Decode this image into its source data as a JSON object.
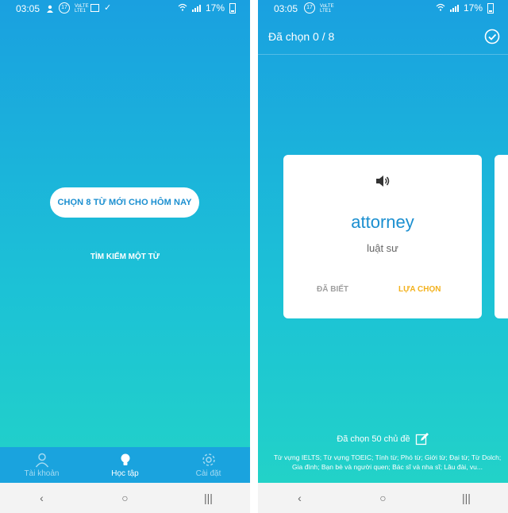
{
  "status_bar": {
    "time": "03:05",
    "battery": "17%",
    "left_badge": "17",
    "network_label": "VoLTE LTE1"
  },
  "left_screen": {
    "primary_button": "CHỌN 8 TỪ MỚI CHO HÔM NAY",
    "search_link": "TÌM KIẾM MỘT TỪ",
    "nav": [
      {
        "label": "Tài khoản",
        "icon": "person-icon"
      },
      {
        "label": "Học tập",
        "icon": "lightbulb-icon"
      },
      {
        "label": "Cài đặt",
        "icon": "gear-icon"
      }
    ]
  },
  "right_screen": {
    "header_title": "Đã chọn 0 / 8",
    "card": {
      "word": "attorney",
      "meaning": "luật sư",
      "known_label": "ĐÃ BIẾT",
      "select_label": "LỰA CHỌN"
    },
    "topics_title": "Đã chọn 50 chủ đề",
    "topics_list": "Từ vựng IELTS; Từ vựng TOEIC; Tính từ; Phó từ; Giới từ; Đại từ; Từ Dolch; Gia đình; Bạn bè và người quen; Bác sĩ và nha sĩ; Lâu đài, vu..."
  },
  "system_nav": {
    "back": "‹",
    "home": "○",
    "recents": "|||"
  },
  "colors": {
    "gradient_top": "#1aa0e0",
    "gradient_bottom": "#22d2c8",
    "accent_blue": "#1b8fd0",
    "accent_yellow": "#f3b21e"
  }
}
